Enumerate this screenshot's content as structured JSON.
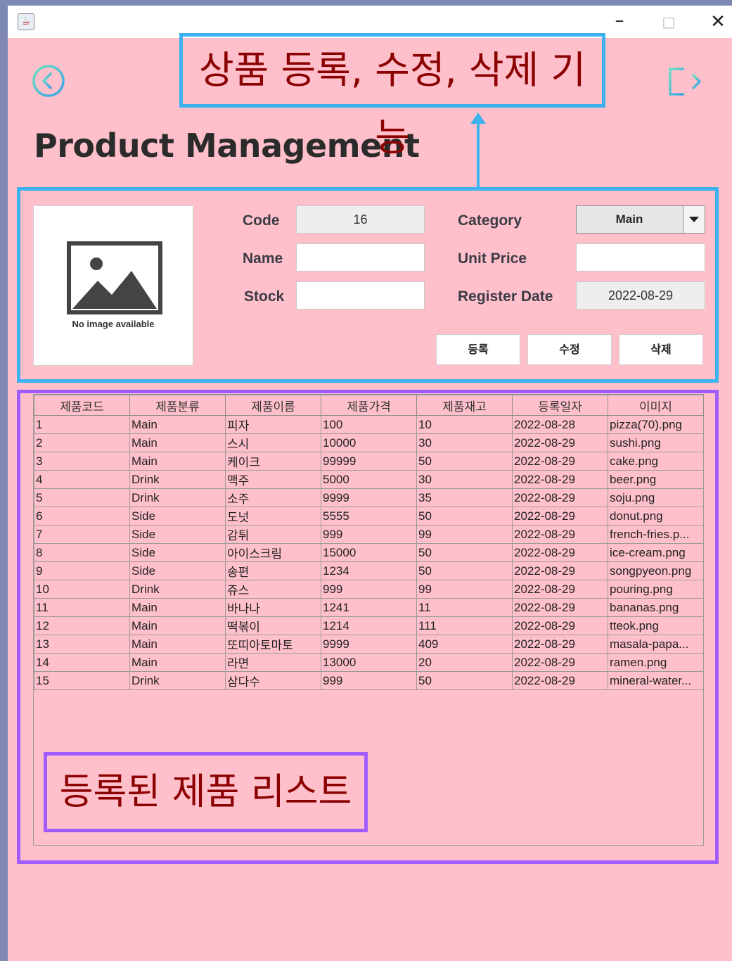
{
  "window": {
    "app_icon": "java-app-icon",
    "minimize": "–",
    "maximize": "□",
    "close": "✕"
  },
  "nav": {
    "back_icon": "back-circle-icon",
    "exit_icon": "logout-icon"
  },
  "page_title": "Product Management",
  "annotations": {
    "top": "상품 등록, 수정, 삭제 기능",
    "bottom": "등록된 제품 리스트"
  },
  "form": {
    "image_caption": "No image available",
    "code_label": "Code",
    "code_value": "16",
    "name_label": "Name",
    "name_value": "",
    "stock_label": "Stock",
    "stock_value": "",
    "category_label": "Category",
    "category_value": "Main",
    "price_label": "Unit Price",
    "price_value": "",
    "date_label": "Register Date",
    "date_value": "2022-08-29",
    "register_button": "등록",
    "edit_button": "수정",
    "delete_button": "삭제"
  },
  "table": {
    "headers": [
      "제품코드",
      "제품분류",
      "제품이름",
      "제품가격",
      "제품재고",
      "등록일자",
      "이미지"
    ],
    "rows": [
      [
        "1",
        "Main",
        "피자",
        "100",
        "10",
        "2022-08-28",
        "pizza(70).png"
      ],
      [
        "2",
        "Main",
        "스시",
        "10000",
        "30",
        "2022-08-29",
        "sushi.png"
      ],
      [
        "3",
        "Main",
        "케이크",
        "99999",
        "50",
        "2022-08-29",
        "cake.png"
      ],
      [
        "4",
        "Drink",
        "맥주",
        "5000",
        "30",
        "2022-08-29",
        "beer.png"
      ],
      [
        "5",
        "Drink",
        "소주",
        "9999",
        "35",
        "2022-08-29",
        "soju.png"
      ],
      [
        "6",
        "Side",
        "도넛",
        "5555",
        "50",
        "2022-08-29",
        "donut.png"
      ],
      [
        "7",
        "Side",
        "감튀",
        "999",
        "99",
        "2022-08-29",
        "french-fries.p..."
      ],
      [
        "8",
        "Side",
        "아이스크림",
        "15000",
        "50",
        "2022-08-29",
        "ice-cream.png"
      ],
      [
        "9",
        "Side",
        "송편",
        "1234",
        "50",
        "2022-08-29",
        "songpyeon.png"
      ],
      [
        "10",
        "Drink",
        "쥬스",
        "999",
        "99",
        "2022-08-29",
        "pouring.png"
      ],
      [
        "11",
        "Main",
        "바나나",
        "1241",
        "11",
        "2022-08-29",
        "bananas.png"
      ],
      [
        "12",
        "Main",
        "떡볶이",
        "1214",
        "111",
        "2022-08-29",
        "tteok.png"
      ],
      [
        "13",
        "Main",
        "또띠아토마토",
        "9999",
        "409",
        "2022-08-29",
        "masala-papa..."
      ],
      [
        "14",
        "Main",
        "라면",
        "13000",
        "20",
        "2022-08-29",
        "ramen.png"
      ],
      [
        "15",
        "Drink",
        "삼다수",
        "999",
        "50",
        "2022-08-29",
        "mineral-water..."
      ]
    ]
  }
}
